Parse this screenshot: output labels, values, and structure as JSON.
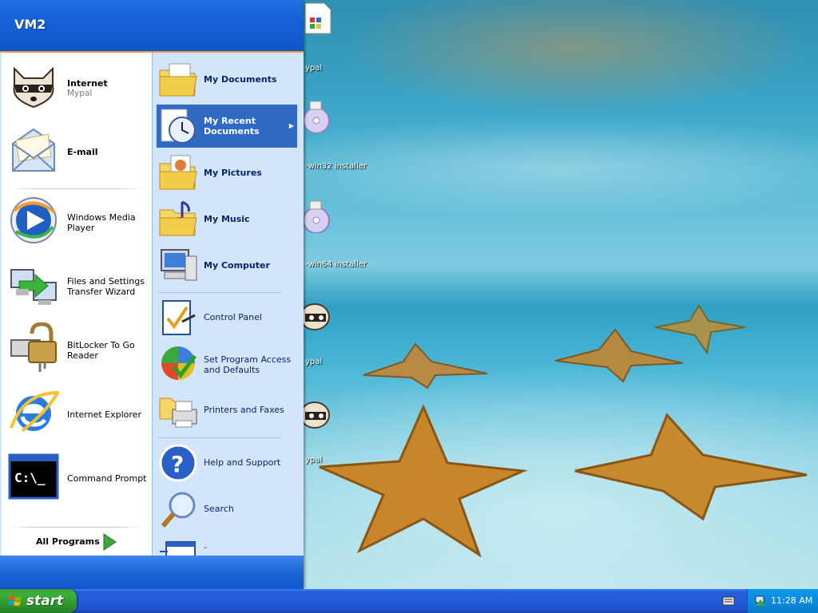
{
  "start_menu": {
    "user_name": "VM2",
    "pinned": [
      {
        "title": "Internet",
        "subtitle": "Mypal"
      },
      {
        "title": "E-mail"
      }
    ],
    "recent_programs": [
      {
        "line1": "Windows Media",
        "line2": "Player"
      },
      {
        "line1": "Files and Settings",
        "line2": "Transfer Wizard"
      },
      {
        "line1": "BitLocker To Go",
        "line2": "Reader"
      },
      {
        "line1": "Internet Explorer"
      },
      {
        "line1": "Command Prompt"
      }
    ],
    "all_programs_label": "All Programs",
    "places": [
      {
        "line1": "My Documents"
      },
      {
        "line1": "My Recent",
        "line2": "Documents"
      },
      {
        "line1": "My Pictures"
      },
      {
        "line1": "My Music"
      },
      {
        "line1": "My Computer"
      }
    ],
    "settings": [
      {
        "line1": "Control Panel"
      },
      {
        "line1": "Set Program Access",
        "line2": "and Defaults"
      },
      {
        "line1": "Printers and Faxes"
      }
    ],
    "help": [
      {
        "line1": "Help and Support"
      },
      {
        "line1": "Search"
      },
      {
        "line1": "-"
      }
    ]
  },
  "desktop_icons": [
    {
      "label": "ypal",
      "icon": "document-icon"
    },
    {
      "label": "-win32 installer",
      "icon": "installer-cd-icon"
    },
    {
      "label": "-win64 installer",
      "icon": "installer-cd-icon"
    },
    {
      "label": "ypal",
      "icon": "mypal-raccoon-icon"
    },
    {
      "label": "ypal",
      "icon": "mypal-raccoon-icon"
    }
  ],
  "taskbar": {
    "start_label": "start",
    "clock": "11:28 AM"
  }
}
